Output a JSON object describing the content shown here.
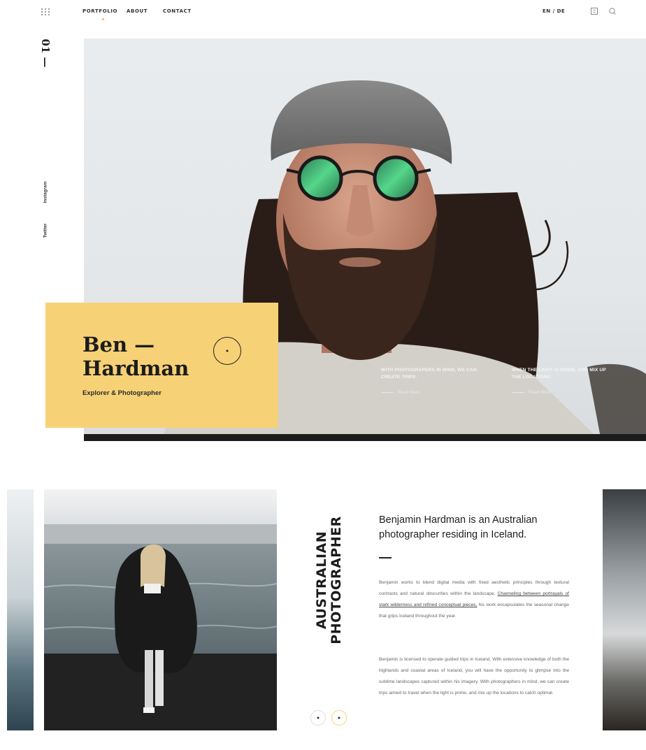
{
  "nav": {
    "items": [
      "PORTFOLIO",
      "ABOUT",
      "CONTACT"
    ],
    "lang": "EN / DE"
  },
  "rail": {
    "slide_number": "01 —",
    "social": [
      "Instagram",
      "Twitter"
    ]
  },
  "hero": {
    "name_line1": "Ben —",
    "name_line2": "Hardman",
    "role": "Explorer & Photographer",
    "caption1": "WITH PHOTOGRAPERS IN MIND, WE CAN CREATE TRIPS.",
    "caption2": "WHEN THE LIGHT IS PRIME, AND MIX UP THE LOCATIONS.",
    "read_more": "Read More"
  },
  "about": {
    "vertical_line1": "AUSTRALIAN",
    "vertical_line2": "PHOTOGRAPHER",
    "title": "Benjamin Hardman is an Australian photographer residing in Iceland.",
    "p1_a": "Benjamin works to blend digital media with fixed aesthetic principles through textural contrasts and natural obscurities within the landscape. ",
    "p1_link": "Channeling between portrayals of stark wilderness and refined conceptual pieces,",
    "p1_b": " his work encapsulates the seasonal change that grips Iceland throughout the year.",
    "p2": "Benjamin is licensed to operate guided trips in Iceland. With extensive knowledge of both the highlands and coastal areas of Iceland, you will have the opportunity to glimpse into the sublime landscapes captured within his imagery. With photographers in mind, we can create trips aimed to travel when the light is prime, and mix up the locations to catch optimal."
  },
  "colors": {
    "accent": "#f7d176",
    "text": "#1a1a1a"
  }
}
